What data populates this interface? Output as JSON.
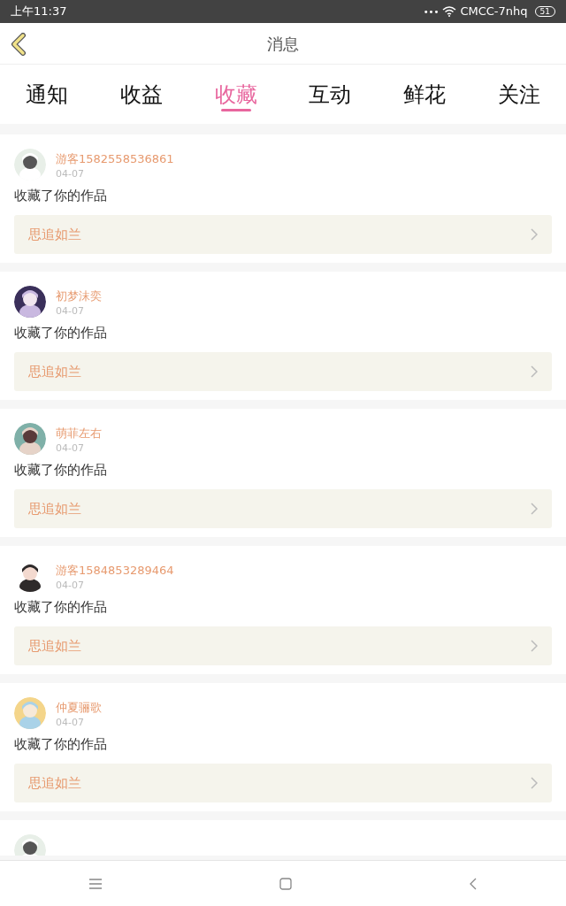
{
  "status_bar": {
    "time": "上午11:37",
    "dots": "•••",
    "network": "CMCC-7nhq",
    "battery": "51"
  },
  "header": {
    "title": "消息"
  },
  "tabs": [
    {
      "label": "通知",
      "selected": false
    },
    {
      "label": "收益",
      "selected": false
    },
    {
      "label": "收藏",
      "selected": true
    },
    {
      "label": "互动",
      "selected": false
    },
    {
      "label": "鲜花",
      "selected": false
    },
    {
      "label": "关注",
      "selected": false
    }
  ],
  "messages": [
    {
      "user": "游客1582558536861",
      "date": "04-07",
      "action": "收藏了你的作品",
      "work": "思追如兰"
    },
    {
      "user": "初梦沫奕",
      "date": "04-07",
      "action": "收藏了你的作品",
      "work": "思追如兰"
    },
    {
      "user": "萌菲左右",
      "date": "04-07",
      "action": "收藏了你的作品",
      "work": "思追如兰"
    },
    {
      "user": "游客1584853289464",
      "date": "04-07",
      "action": "收藏了你的作品",
      "work": "思追如兰"
    },
    {
      "user": "仲夏骊歌",
      "date": "04-07",
      "action": "收藏了你的作品",
      "work": "思追如兰"
    }
  ]
}
